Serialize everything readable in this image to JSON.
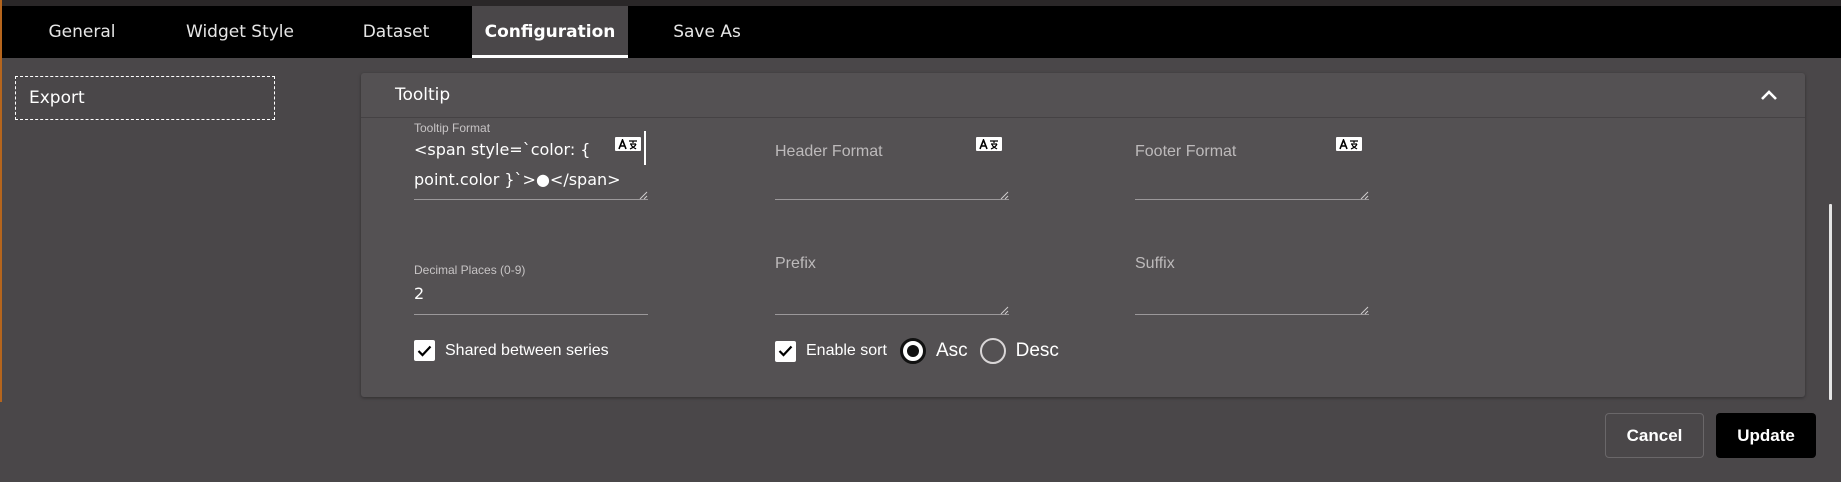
{
  "tabs": [
    {
      "label": "General",
      "active": false
    },
    {
      "label": "Widget Style",
      "active": false
    },
    {
      "label": "Dataset",
      "active": false
    },
    {
      "label": "Configuration",
      "active": true
    },
    {
      "label": "Save As",
      "active": false
    }
  ],
  "sidebar": {
    "items": [
      {
        "label": "Export"
      }
    ]
  },
  "panel": {
    "title": "Tooltip",
    "tooltip_format": {
      "label": "Tooltip Format",
      "value_line1": "<span style=`color: {",
      "value_line2": "point.color }`>●</span>"
    },
    "header_format": {
      "label": "Header Format",
      "value": ""
    },
    "footer_format": {
      "label": "Footer Format",
      "value": ""
    },
    "decimal_places": {
      "label": "Decimal Places (0-9)",
      "value": "2"
    },
    "prefix": {
      "label": "Prefix",
      "value": ""
    },
    "suffix": {
      "label": "Suffix",
      "value": ""
    },
    "shared_between_series": {
      "label": "Shared between series",
      "checked": true
    },
    "enable_sort": {
      "label": "Enable sort",
      "checked": true
    },
    "sort_order": {
      "options": [
        "Asc",
        "Desc"
      ],
      "selected": "Asc"
    }
  },
  "actions": {
    "cancel_label": "Cancel",
    "update_label": "Update"
  },
  "icons": {
    "collapse": "chevron-up-icon",
    "translate": "translate-icon",
    "check": "check-icon"
  },
  "colors": {
    "tabbar_bg": "#000000",
    "page_bg": "#4a4749",
    "panel_bg": "#545153",
    "accent": "#ffffff"
  }
}
